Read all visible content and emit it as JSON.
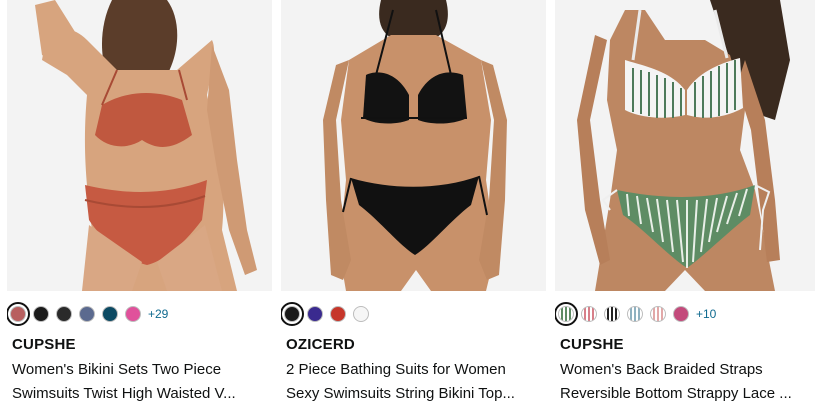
{
  "products": [
    {
      "brand": "CUPSHE",
      "title_line1": "Women's Bikini Sets Two Piece",
      "title_line2": "Swimsuits Twist High Waisted V...",
      "swatches": [
        "#b85f5f",
        "#1b1b1b",
        "#2a2a2a",
        "#5b6a8f",
        "#0c4a63",
        "#e0519b"
      ],
      "more": "+29"
    },
    {
      "brand": "OZICERD",
      "title_line1": "2 Piece Bathing Suits for Women",
      "title_line2": "Sexy Swimsuits String Bikini Top...",
      "swatches": [
        "#1a1a1a",
        "#3a2a8f",
        "#c6362a",
        "#f6f6f6"
      ],
      "more": ""
    },
    {
      "brand": "CUPSHE",
      "title_line1": "Women's Back Braided Straps",
      "title_line2": "Reversible Bottom Strappy Lace ...",
      "swatches": [
        "#e6e6e6",
        "#e9bcbf",
        "#2f2f2f",
        "#c9d8df",
        "#f0dede",
        "#c34a7b"
      ],
      "more": "+10"
    }
  ]
}
